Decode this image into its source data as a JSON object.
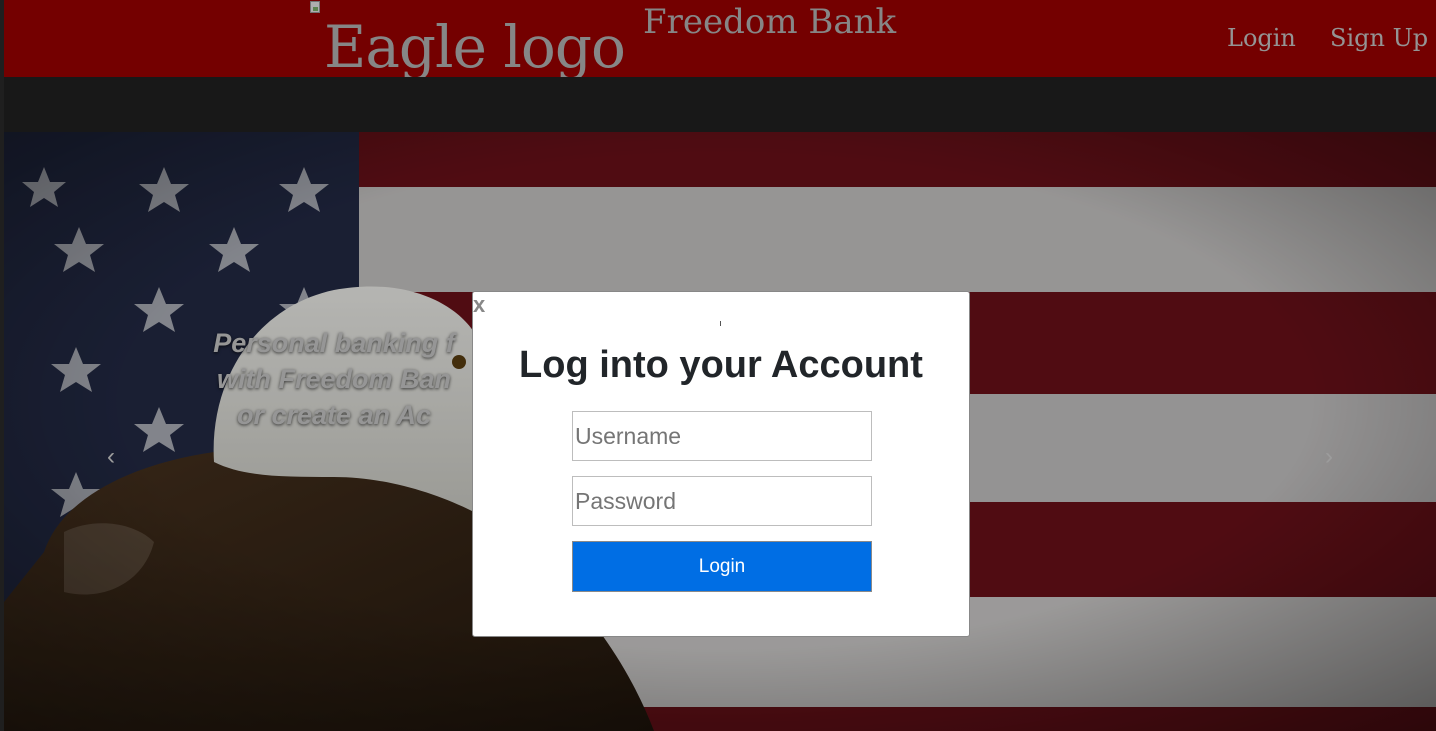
{
  "header": {
    "logo_alt": "Eagle logo",
    "brand": "Freedom Bank",
    "nav": {
      "login": "Login",
      "signup": "Sign Up"
    },
    "background": "#9b0000"
  },
  "hero": {
    "caption_lines": [
      "Personal banking f",
      "with Freedom Ban",
      "or create an Ac"
    ],
    "prev_icon": "‹",
    "next_icon": "›"
  },
  "modal": {
    "close": "x",
    "title": "Log into your Account",
    "username_placeholder": "Username",
    "password_placeholder": "Password",
    "submit_label": "Login",
    "button_color": "#006ee4"
  }
}
